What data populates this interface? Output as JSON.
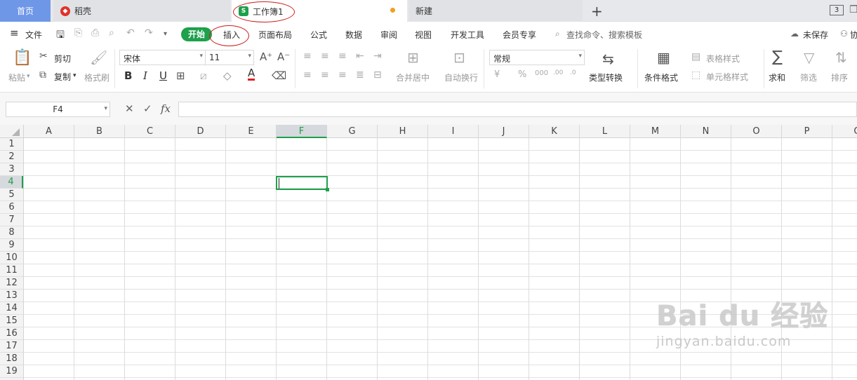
{
  "tabs": {
    "home": "首页",
    "docer": "稻壳",
    "document": "工作簿1",
    "new": "新建",
    "add": "+"
  },
  "menu": {
    "file": "文件",
    "start": "开始",
    "insert": "插入",
    "page_layout": "页面布局",
    "formula": "公式",
    "data": "数据",
    "review": "审阅",
    "view": "视图",
    "dev_tools": "开发工具",
    "member": "会员专享",
    "search_placeholder": "查找命令、搜索模板",
    "unsaved": "未保存",
    "collab": "协"
  },
  "ribbon": {
    "paste": "粘贴",
    "cut": "剪切",
    "copy": "复制",
    "format_painter": "格式刷",
    "font_name": "宋体",
    "font_size": "11",
    "merge_center": "合并居中",
    "wrap_text": "自动换行",
    "number_format": "常规",
    "type_convert": "类型转换",
    "cond_format": "条件格式",
    "table_style": "表格样式",
    "cell_style": "单元格样式",
    "sum": "求和",
    "filter": "筛选",
    "sort": "排序",
    "bold": "B",
    "italic": "I",
    "underline": "U"
  },
  "formula_bar": {
    "name_box": "F4",
    "fx": "fx",
    "value": ""
  },
  "grid": {
    "columns": [
      "A",
      "B",
      "C",
      "D",
      "E",
      "F",
      "G",
      "H",
      "I",
      "J",
      "K",
      "L",
      "M",
      "N",
      "O",
      "P",
      "Q"
    ],
    "rows": [
      "1",
      "2",
      "3",
      "4",
      "5",
      "6",
      "7",
      "8",
      "9",
      "10",
      "11",
      "12",
      "13",
      "14",
      "15",
      "16",
      "17",
      "18",
      "19"
    ],
    "selected_column": "F",
    "selected_row": "4",
    "active_cell": "F4"
  },
  "watermark": {
    "brand": "Bai du 经验",
    "url": "jingyan.baidu.com"
  },
  "colors": {
    "accent_green": "#1ea04c",
    "home_tab_blue": "#6f97e8",
    "annotation_red": "#cc1f1f"
  }
}
